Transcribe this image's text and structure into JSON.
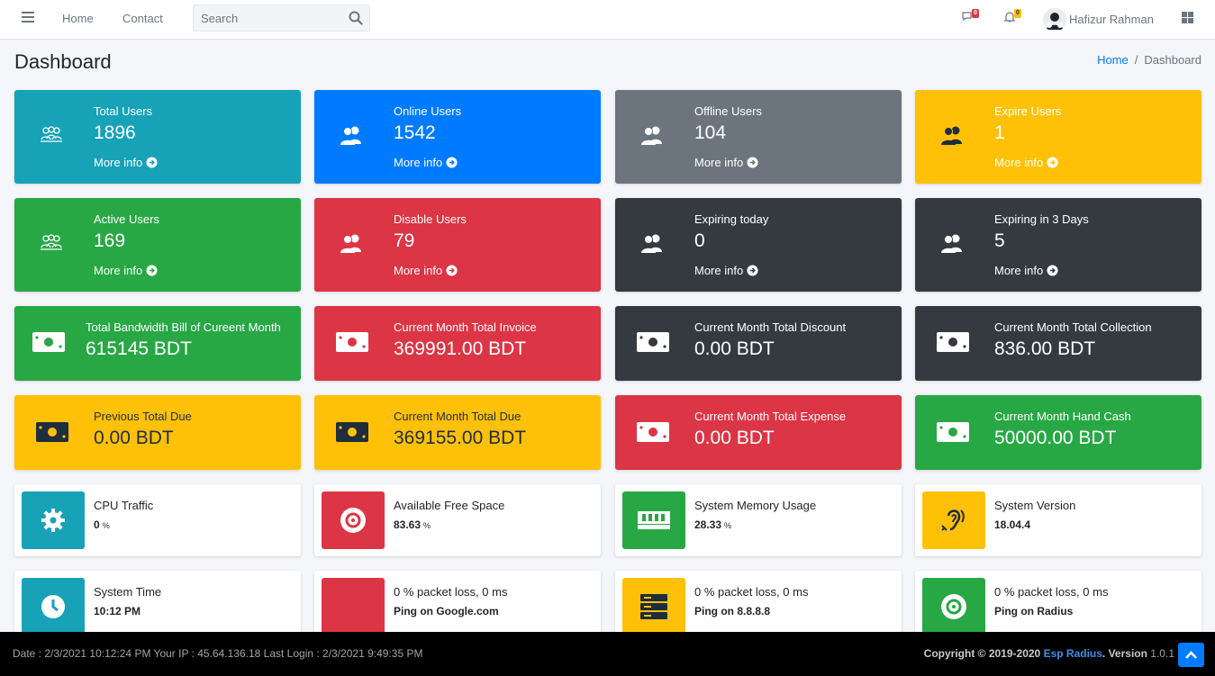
{
  "navbar": {
    "links": [
      "Home",
      "Contact"
    ],
    "search_placeholder": "Search",
    "messages_count": "0",
    "notifications_count": "0",
    "user_name": "Hafizur Rahman"
  },
  "header": {
    "title": "Dashboard",
    "breadcrumb_home": "Home",
    "breadcrumb_sep": "/",
    "breadcrumb_current": "Dashboard"
  },
  "stat_boxes": [
    {
      "label": "Total Users",
      "value": "1896",
      "more": "More info",
      "color": "#17a2b8"
    },
    {
      "label": "Online Users",
      "value": "1542",
      "more": "More info",
      "color": "#007bff"
    },
    {
      "label": "Offline Users",
      "value": "104",
      "more": "More info",
      "color": "#6c757d"
    },
    {
      "label": "Expire Users",
      "value": "1",
      "more": "More info",
      "color": "#ffc107"
    },
    {
      "label": "Active Users",
      "value": "169",
      "more": "More info",
      "color": "#28a745"
    },
    {
      "label": "Disable Users",
      "value": "79",
      "more": "More info",
      "color": "#dc3545"
    },
    {
      "label": "Expiring today",
      "value": "0",
      "more": "More info",
      "color": "#343a40"
    },
    {
      "label": "Expiring in 3 Days",
      "value": "5",
      "more": "More info",
      "color": "#343a40"
    }
  ],
  "money_boxes": [
    {
      "label": "Total Bandwidth Bill of Cureent Month",
      "value": "615145 BDT",
      "color": "#28a745"
    },
    {
      "label": "Current Month Total Invoice",
      "value": "369991.00 BDT",
      "color": "#dc3545"
    },
    {
      "label": "Current Month Total Discount",
      "value": "0.00 BDT",
      "color": "#343a40"
    },
    {
      "label": "Current Month Total Collection",
      "value": "836.00 BDT",
      "color": "#343a40"
    },
    {
      "label": "Previous Total Due",
      "value": "0.00 BDT",
      "color": "#ffc107"
    },
    {
      "label": "Current Month Total Due",
      "value": "369155.00 BDT",
      "color": "#ffc107"
    },
    {
      "label": "Current Month Total Expense",
      "value": "0.00 BDT",
      "color": "#dc3545"
    },
    {
      "label": "Current Month Hand Cash",
      "value": "50000.00 BDT",
      "color": "#28a745"
    }
  ],
  "info_boxes": [
    {
      "label": "CPU Traffic",
      "value": "0",
      "unit": "%",
      "icon": "gear-icon",
      "color": "#17a2b8"
    },
    {
      "label": "Available Free Space",
      "value": "83.63",
      "unit": "%",
      "icon": "disk-icon",
      "color": "#dc3545"
    },
    {
      "label": "System Memory Usage",
      "value": "28.33",
      "unit": "%",
      "icon": "memory-icon",
      "color": "#28a745"
    },
    {
      "label": "System Version",
      "value": "18.04.4",
      "unit": "",
      "icon": "ear-icon",
      "color": "#ffc107"
    },
    {
      "label": "System Time",
      "value": "10:12 PM",
      "unit": "",
      "icon": "clock-icon",
      "color": "#17a2b8"
    },
    {
      "label": "0 % packet loss, 0 ms",
      "value": "Ping on Google.com",
      "unit": "",
      "icon": "blank",
      "color": "#dc3545"
    },
    {
      "label": "0 % packet loss, 0 ms",
      "value": "Ping on 8.8.8.8",
      "unit": "",
      "icon": "server-icon",
      "color": "#ffc107"
    },
    {
      "label": "0 % packet loss, 0 ms",
      "value": "Ping on Radius",
      "unit": "",
      "icon": "disk-icon",
      "color": "#28a745"
    }
  ],
  "footer": {
    "left": "Date : 2/3/2021 10:12:24 PM Your IP : 45.64.136.18 Last Login : 2/3/2021 9:49:35 PM",
    "copyright": "Copyright © 2019-2020",
    "brand": "Esp Radius",
    "version_label": ". Version",
    "version": "1.0.1"
  }
}
